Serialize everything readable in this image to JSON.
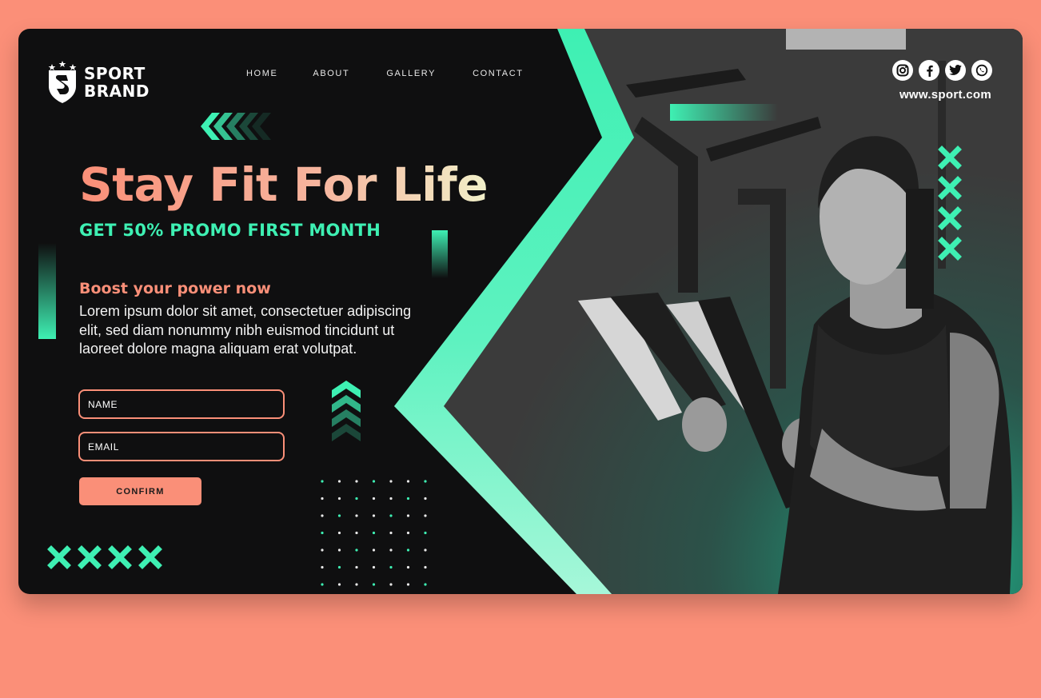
{
  "brand": {
    "line1": "SPORT",
    "line2": "BRAND"
  },
  "nav": [
    {
      "label": "HOME"
    },
    {
      "label": "ABOUT"
    },
    {
      "label": "GALLERY"
    },
    {
      "label": "CONTACT"
    }
  ],
  "social": {
    "icons": [
      "instagram-icon",
      "facebook-icon",
      "twitter-icon",
      "whatsapp-icon"
    ],
    "url": "www.sport.com"
  },
  "hero": {
    "title": "Stay Fit For Life",
    "promo": "GET 50% PROMO FIRST MONTH",
    "subheading": "Boost your power now",
    "body": "Lorem ipsum dolor sit amet, consectetuer adipiscing elit, sed diam nonummy nibh euismod tincidunt ut laoreet dolore magna aliquam erat volutpat."
  },
  "form": {
    "name_placeholder": "NAME",
    "email_placeholder": "EMAIL",
    "confirm_label": "CONFIRM"
  },
  "colors": {
    "accent": "#3ef0b3",
    "coral": "#fa8f78",
    "dark": "#0f0f10"
  }
}
